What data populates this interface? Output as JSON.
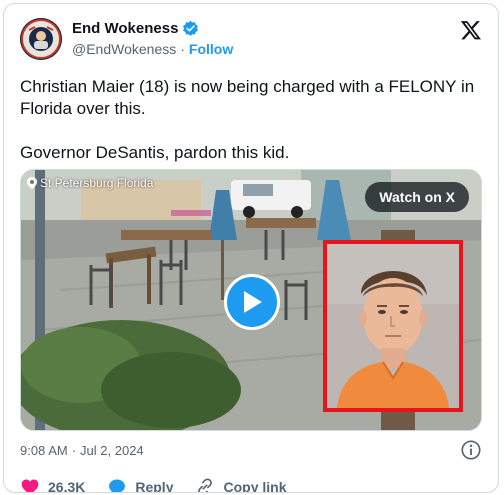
{
  "author": {
    "display_name": "End Wokeness",
    "handle": "@EndWokeness",
    "follow_label": "Follow",
    "verified_color": "#1d9bf0"
  },
  "tweet": {
    "line1": "Christian Maier (18) is now being charged with a FELONY in Florida over this.",
    "line2": "Governor DeSantis, pardon this kid."
  },
  "media": {
    "location": "St Petersburg Florida",
    "watch_label": "Watch on X"
  },
  "meta": {
    "time": "9:08 AM",
    "separator": "·",
    "date": "Jul 2, 2024"
  },
  "actions": {
    "likes": "26.3K",
    "reply_label": "Reply",
    "copy_label": "Copy link"
  },
  "colors": {
    "accent": "#1d9bf0",
    "like": "#f91880",
    "mugshot_border": "#e8141b"
  }
}
